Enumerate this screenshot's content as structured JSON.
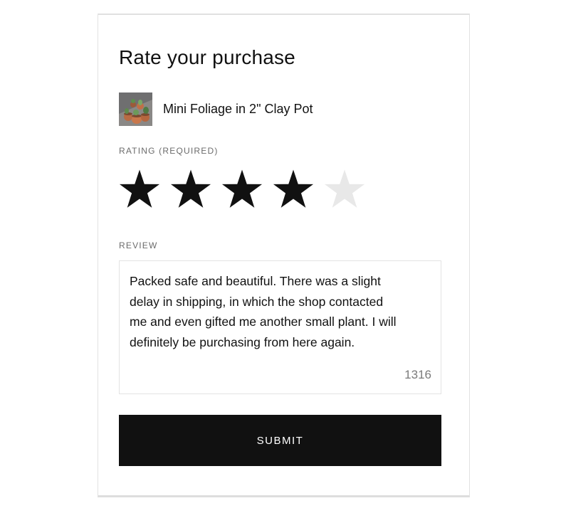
{
  "form": {
    "title": "Rate your purchase",
    "product": {
      "name": "Mini Foliage in 2\" Clay Pot",
      "thumbnail": "potted-plants-image"
    },
    "rating": {
      "label": "RATING (REQUIRED)",
      "value": 4,
      "max": 5,
      "filled_color": "#111111",
      "empty_color": "#e8e8e8"
    },
    "review": {
      "label": "REVIEW",
      "text": "Packed safe and beautiful. There was a slight delay in shipping, in which the shop contacted me and even gifted me another small plant. I will definitely be purchasing from here again.",
      "char_count": "1316"
    },
    "submit_label": "SUBMIT"
  }
}
